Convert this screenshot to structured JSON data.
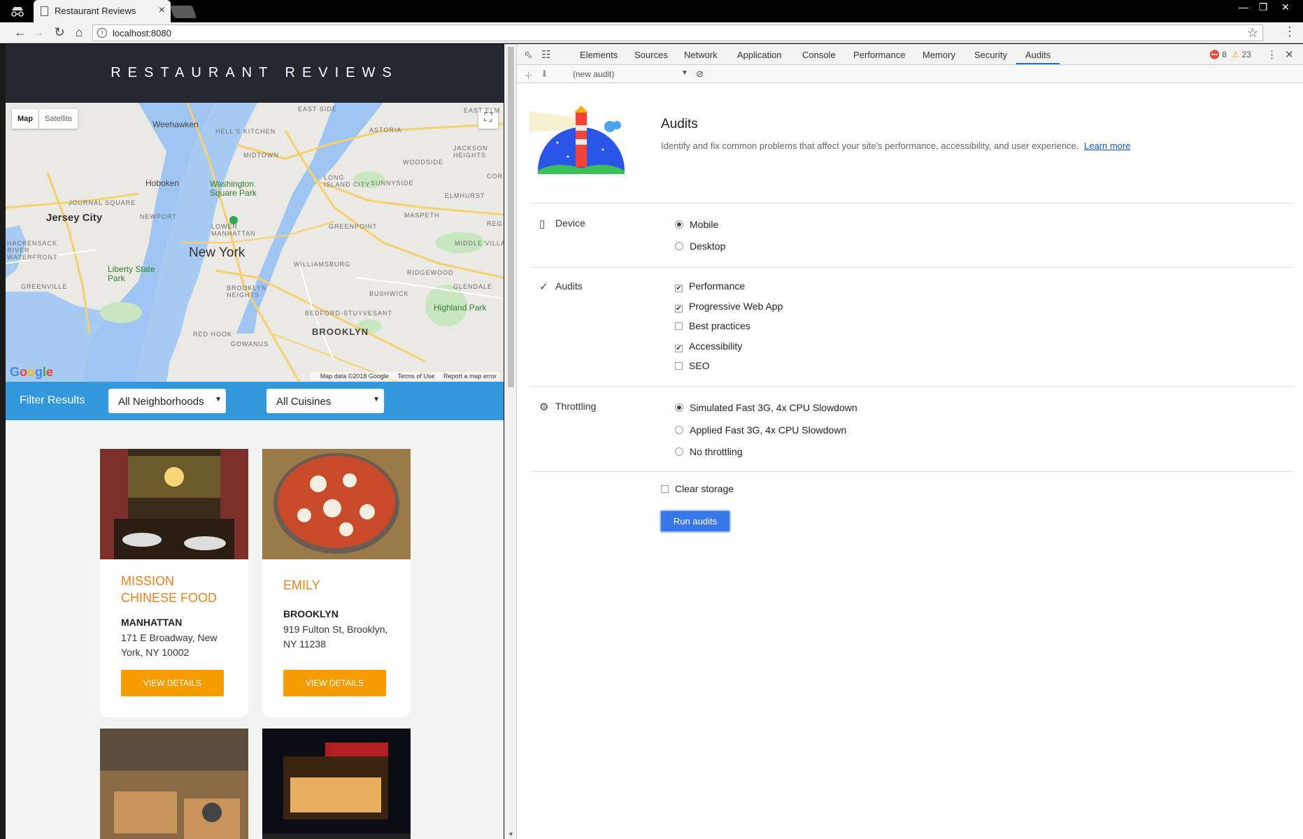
{
  "browser": {
    "tab_title": "Restaurant Reviews",
    "tab_close": "×",
    "url": "localhost:8080",
    "window_controls": [
      "—",
      "❐",
      "✕"
    ]
  },
  "site": {
    "header_title": "RESTAURANT REVIEWS",
    "map": {
      "type_buttons": [
        "Map",
        "Satellite"
      ],
      "fullscreen_icon": "⛶",
      "labels": {
        "weehawken": "Weehawken",
        "hells_kitchen": "HELL'S KITCHEN",
        "midtown": "MIDTOWN",
        "east_side": "EAST SIDE",
        "astoria": "ASTORIA",
        "jackson_heights": "JACKSON HEIGHTS",
        "hoboken": "Hoboken",
        "washington_sq": "Washington Square Park",
        "long_island_city": "LONG ISLAND CITY",
        "sunnyside": "SUNNYSIDE",
        "woodside": "WOODSIDE",
        "elmhurst": "ELMHURST",
        "journal_square": "JOURNAL SQUARE",
        "jersey_city": "Jersey City",
        "newport": "NEWPORT",
        "lower_manhattan": "LOWER MANHATTAN",
        "maspeth": "MASPETH",
        "greenpoint": "GREENPOINT",
        "hackensack": "HACKENSACK RIVER WATERFRONT",
        "new_york": "New York",
        "williamsburg": "WILLIAMSBURG",
        "middle_village": "MIDDLE VILLA",
        "liberty": "Liberty State Park",
        "ridgewood": "RIDGEWOOD",
        "glendale": "GLENDALE",
        "greenville": "GREENVILLE",
        "brooklyn_heights": "BROOKLYN HEIGHTS",
        "bushwick": "BUSHWICK",
        "highland_park": "Highland Park",
        "bed_stuy": "BEDFORD-STUYVESANT",
        "red_hook": "RED HOOK",
        "gowanus": "GOWANUS",
        "brooklyn": "BROOKLYN",
        "east_elm": "EAST ELM",
        "cor": "COR",
        "reg": "REG"
      },
      "google_logo": "Google",
      "footer": [
        "Map data ©2018 Google",
        "Terms of Use",
        "Report a map error"
      ]
    },
    "filter": {
      "label": "Filter Results",
      "neighborhoods": "All Neighborhoods",
      "cuisines": "All Cuisines"
    },
    "restaurants": [
      {
        "name": "MISSION CHINESE FOOD",
        "neighborhood": "MANHATTAN",
        "address": "171 E Broadway, New York, NY 10002",
        "button": "VIEW DETAILS"
      },
      {
        "name": "EMILY",
        "neighborhood": "BROOKLYN",
        "address": "919 Fulton St, Brooklyn, NY 11238",
        "button": "VIEW DETAILS"
      }
    ]
  },
  "devtools": {
    "tabs": [
      "Elements",
      "Sources",
      "Network",
      "Application",
      "Console",
      "Performance",
      "Memory",
      "Security",
      "Audits"
    ],
    "active_tab": "Audits",
    "error_count": "8",
    "warning_count": "23",
    "audit_select": "(new audit)",
    "audits": {
      "title": "Audits",
      "description": "Identify and fix common problems that affect your site's performance, accessibility, and user experience.",
      "learn_more": "Learn more",
      "device_label": "Device",
      "device_options": [
        "Mobile",
        "Desktop"
      ],
      "device_selected": "Mobile",
      "audits_label": "Audits",
      "audit_options": [
        {
          "label": "Performance",
          "checked": true
        },
        {
          "label": "Progressive Web App",
          "checked": true
        },
        {
          "label": "Best practices",
          "checked": false
        },
        {
          "label": "Accessibility",
          "checked": true
        },
        {
          "label": "SEO",
          "checked": false
        }
      ],
      "throttling_label": "Throttling",
      "throttling_options": [
        "Simulated Fast 3G, 4x CPU Slowdown",
        "Applied Fast 3G, 4x CPU Slowdown",
        "No throttling"
      ],
      "throttling_selected": "Simulated Fast 3G, 4x CPU Slowdown",
      "clear_storage": "Clear storage",
      "clear_storage_checked": false,
      "run_button": "Run audits"
    }
  }
}
